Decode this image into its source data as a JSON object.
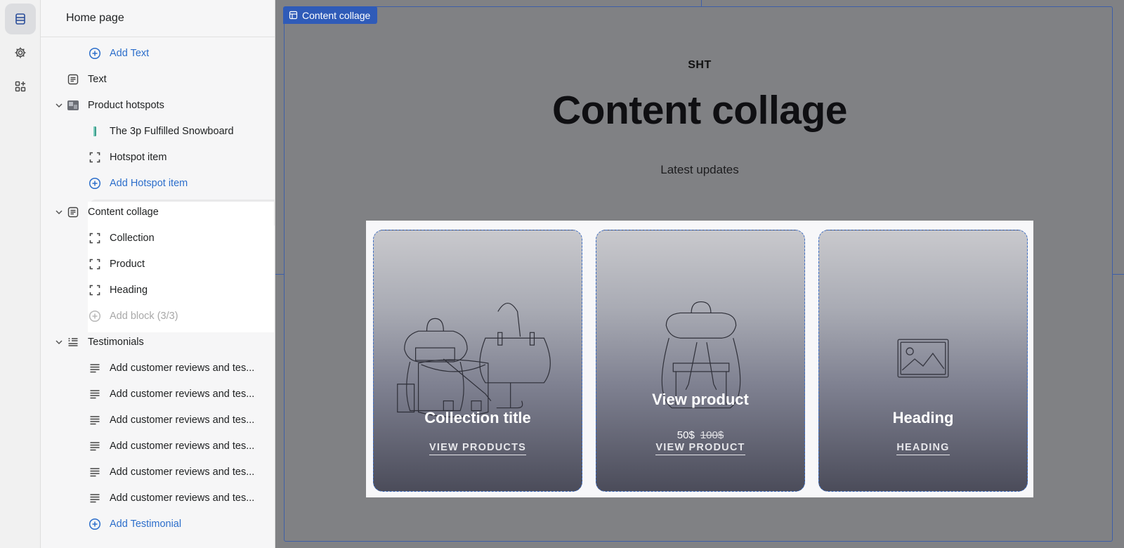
{
  "sidebar": {
    "title": "Home page",
    "rows": {
      "add_text": "Add Text",
      "text": "Text",
      "product_hotspots": "Product hotspots",
      "snowboard": "The 3p Fulfilled Snowboard",
      "hotspot_item": "Hotspot item",
      "add_hotspot": "Add Hotspot item",
      "content_collage": "Content collage",
      "collection": "Collection",
      "product": "Product",
      "heading": "Heading",
      "add_block": "Add block (3/3)",
      "testimonials": "Testimonials",
      "testimonial_1": "Add customer reviews and tes...",
      "testimonial_2": "Add customer reviews and tes...",
      "testimonial_3": "Add customer reviews and tes...",
      "testimonial_4": "Add customer reviews and tes...",
      "testimonial_5": "Add customer reviews and tes...",
      "testimonial_6": "Add customer reviews and tes...",
      "add_testimonial": "Add Testimonial"
    }
  },
  "preview": {
    "section_tag": "Content collage",
    "eyebrow": "SHT",
    "headline": "Content collage",
    "subline": "Latest updates",
    "cards": [
      {
        "title": "Collection title",
        "link": "VIEW PRODUCTS"
      },
      {
        "title": "View product",
        "price": "50$",
        "compare_price": "100$",
        "link": "VIEW PRODUCT"
      },
      {
        "title": "Heading",
        "link": "HEADING"
      }
    ]
  },
  "colors": {
    "accent": "#2c6ecb",
    "section_outline": "#3e5fa8",
    "overlay": "#808184"
  },
  "icons": [
    "sections-icon",
    "gear-icon",
    "apps-icon",
    "plus-circle-icon",
    "text-block-icon",
    "image-thumb-icon",
    "block-frame-icon",
    "testimonial-icon",
    "chevron-down-icon"
  ]
}
